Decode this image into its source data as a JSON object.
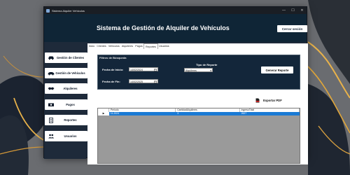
{
  "window": {
    "title": "Sistema Alquiler Vehiculos",
    "controls": {
      "minimize": "—",
      "maximize": "☐",
      "close": "✕"
    }
  },
  "header": {
    "title": "Sistema de Gestión de Alquiler de Vehículos",
    "logout_label": "Cerrar sesión"
  },
  "sidebar": {
    "items": [
      {
        "label": "Gestión de Clientes",
        "icon": "car-icon"
      },
      {
        "label": "Gestión de Vehículos",
        "icon": "car-side-icon"
      },
      {
        "label": "Alquileres",
        "icon": "handshake-icon"
      },
      {
        "label": "Pagos",
        "icon": "money-icon"
      },
      {
        "label": "Reportes",
        "icon": "report-icon"
      },
      {
        "label": "Usuarios",
        "icon": "users-icon"
      }
    ]
  },
  "tabs": [
    {
      "label": "Inicio"
    },
    {
      "label": "Clientes"
    },
    {
      "label": "Vehiculos"
    },
    {
      "label": "Alquileres"
    },
    {
      "label": "Pagos"
    },
    {
      "label": "Reportes",
      "active": true
    },
    {
      "label": "Usuarios"
    }
  ],
  "filters": {
    "group_title": "Filtros de Búsqueda",
    "start_label": "Fecha de Inicio:",
    "start_value": "14/02/2024",
    "end_label": "Fecha de Fin:",
    "end_value": "14/02/2025",
    "type_label": "Tipo de Reporte",
    "type_value": "Alquileres",
    "generate_label": "Generar Reporte"
  },
  "export": {
    "label": "Exportar PDF",
    "icon": "pdf-icon"
  },
  "grid": {
    "columns": [
      "Periodo",
      "CantidadAlquileres",
      "IngresoTotal"
    ],
    "rows": [
      {
        "marker": "▶",
        "cells": [
          "11-2024",
          "3",
          "2627"
        ]
      }
    ]
  },
  "colors": {
    "accent": "#1a7ad4",
    "header_bg": "#0f2536",
    "window_bg": "#1e2a3a"
  }
}
